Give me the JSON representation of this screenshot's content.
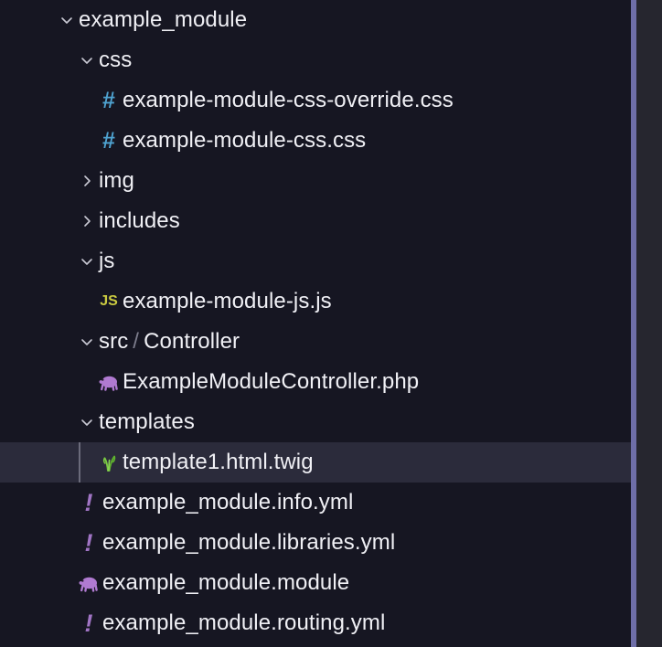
{
  "explorer": {
    "title": "example_module file tree",
    "background_color": "#161622",
    "selected_row_color": "#2b2b3b",
    "scrollbar_color": "#6e6ea8",
    "gutter_color": "#26262f",
    "indent_guide_color": "#6b6b7b"
  },
  "rows": [
    {
      "label": "example_module",
      "icon": "chevron-down-icon",
      "icon_glyph": "",
      "kind": "folder",
      "state": "expanded",
      "depth": 0,
      "selected": false,
      "guide": false
    },
    {
      "label": "css",
      "icon": "chevron-down-icon",
      "icon_glyph": "",
      "kind": "folder",
      "state": "expanded",
      "depth": 1,
      "selected": false,
      "guide": false
    },
    {
      "label": "example-module-css-override.css",
      "icon": "css-file-icon",
      "icon_glyph": "#",
      "kind": "file",
      "state": "",
      "depth": 2,
      "selected": false,
      "guide": false
    },
    {
      "label": "example-module-css.css",
      "icon": "css-file-icon",
      "icon_glyph": "#",
      "kind": "file",
      "state": "",
      "depth": 2,
      "selected": false,
      "guide": false
    },
    {
      "label": "img",
      "icon": "chevron-right-icon",
      "icon_glyph": "",
      "kind": "folder",
      "state": "collapsed",
      "depth": 1,
      "selected": false,
      "guide": false
    },
    {
      "label": "includes",
      "icon": "chevron-right-icon",
      "icon_glyph": "",
      "kind": "folder",
      "state": "collapsed",
      "depth": 1,
      "selected": false,
      "guide": false
    },
    {
      "label": "js",
      "icon": "chevron-down-icon",
      "icon_glyph": "",
      "kind": "folder",
      "state": "expanded",
      "depth": 1,
      "selected": false,
      "guide": false
    },
    {
      "label": "example-module-js.js",
      "icon": "js-file-icon",
      "icon_glyph": "JS",
      "kind": "file",
      "state": "",
      "depth": 2,
      "selected": false,
      "guide": false
    },
    {
      "label": "src",
      "label2": "Controller",
      "separator": "/",
      "icon": "chevron-down-icon",
      "icon_glyph": "",
      "kind": "folder",
      "state": "expanded",
      "depth": 1,
      "selected": false,
      "guide": false
    },
    {
      "label": "ExampleModuleController.php",
      "icon": "php-file-icon",
      "icon_glyph": "🐘",
      "kind": "file",
      "state": "",
      "depth": 2,
      "selected": false,
      "guide": false
    },
    {
      "label": "templates",
      "icon": "chevron-down-icon",
      "icon_glyph": "",
      "kind": "folder",
      "state": "expanded",
      "depth": 1,
      "selected": false,
      "guide": false
    },
    {
      "label": "template1.html.twig",
      "icon": "twig-file-icon",
      "icon_glyph": "🌱",
      "kind": "file",
      "state": "",
      "depth": 2,
      "selected": true,
      "guide": true
    },
    {
      "label": "example_module.info.yml",
      "icon": "yaml-file-icon",
      "icon_glyph": "!",
      "kind": "file",
      "state": "",
      "depth": 1,
      "selected": false,
      "guide": false
    },
    {
      "label": "example_module.libraries.yml",
      "icon": "yaml-file-icon",
      "icon_glyph": "!",
      "kind": "file",
      "state": "",
      "depth": 1,
      "selected": false,
      "guide": false
    },
    {
      "label": "example_module.module",
      "icon": "php-file-icon",
      "icon_glyph": "🐘",
      "kind": "file",
      "state": "",
      "depth": 1,
      "selected": false,
      "guide": false
    },
    {
      "label": "example_module.routing.yml",
      "icon": "yaml-file-icon",
      "icon_glyph": "!",
      "kind": "file",
      "state": "",
      "depth": 1,
      "selected": false,
      "guide": false
    }
  ]
}
